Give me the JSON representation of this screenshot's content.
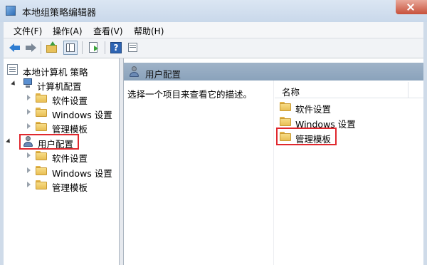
{
  "window": {
    "title": "本地组策略编辑器"
  },
  "menu": {
    "file": "文件(F)",
    "action": "操作(A)",
    "view": "查看(V)",
    "help": "帮助(H)"
  },
  "toolbar": {
    "help_glyph": "?"
  },
  "tree": {
    "root": "本地计算机 策略",
    "computer_config": {
      "label": "计算机配置",
      "children": [
        "软件设置",
        "Windows 设置",
        "管理模板"
      ]
    },
    "user_config": {
      "label": "用户配置",
      "children": [
        "软件设置",
        "Windows 设置",
        "管理模板"
      ]
    }
  },
  "right_pane": {
    "header": "用户配置",
    "description": "选择一个项目来查看它的描述。",
    "column_name": "名称",
    "items": [
      "软件设置",
      "Windows 设置",
      "管理模板"
    ]
  },
  "colors": {
    "highlight": "#e0282e",
    "header_bg": "#9fb3c8",
    "folder": "#f7dc86"
  },
  "icons": [
    "back-arrow-icon",
    "forward-arrow-icon",
    "up-folder-icon",
    "show-hide-tree-icon",
    "export-list-icon",
    "help-icon",
    "properties-icon",
    "folder-icon",
    "user-icon",
    "computer-icon",
    "policy-icon"
  ]
}
